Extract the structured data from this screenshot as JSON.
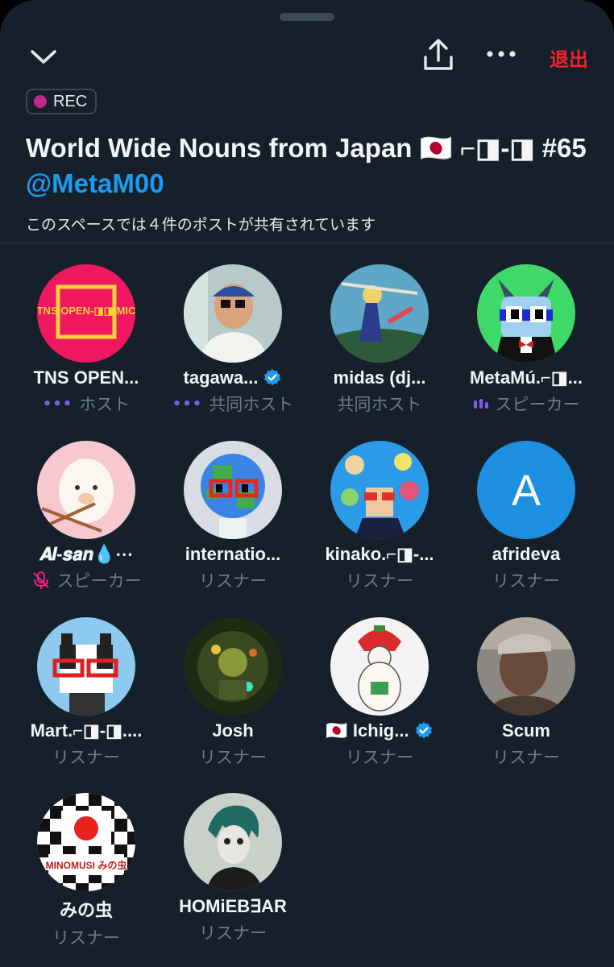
{
  "header": {
    "leave_label": "退出",
    "rec_label": "REC",
    "title_text": "World Wide Nouns from Japan 🇯🇵 ⌐◨-◨ #65",
    "title_handle": "@MetaM00",
    "subtitle": "このスペースでは４件のポストが共有されています",
    "colors": {
      "accent": "#1d9bf0",
      "leave": "#f4212e",
      "rec": "#c2278a",
      "background": "#15202b"
    }
  },
  "participants": [
    {
      "name": "TNS OPEN...",
      "role": "ホスト",
      "role_indicator": "speaking-dots",
      "avatar": "open-mic-logo",
      "avatar_text": "TNS OPEN-◨◨ MIC",
      "avatar_color": "#f0185f"
    },
    {
      "name": "tagawa...",
      "role": "共同ホスト",
      "role_indicator": "speaking-dots",
      "verified": true,
      "avatar": "photo-man-cap",
      "avatar_color": "#b7c9c9"
    },
    {
      "name": "midas (dj...",
      "role": "共同ホスト",
      "avatar": "anime-illustration",
      "avatar_color": "#5fa7c6"
    },
    {
      "name": "MetaMú.⌐◨...",
      "role": "スピーカー",
      "role_indicator": "speaking-bars",
      "avatar": "cat-noggles",
      "avatar_color": "#3fd96a"
    },
    {
      "name": "𝑨𝒍-𝒔𝒂𝒏💧⋯",
      "role": "スピーカー",
      "role_indicator": "mic-muted",
      "avatar": "alpaca",
      "avatar_color": "#f7c8cf"
    },
    {
      "name": "internatio...",
      "role": "リスナー",
      "avatar": "pixel-globe",
      "avatar_color": "#d9dce3"
    },
    {
      "name": "kinako.⌐◨-...",
      "role": "リスナー",
      "avatar": "nouns-bubbles",
      "avatar_color": "#2b9be8"
    },
    {
      "name": "afrideva",
      "role": "リスナー",
      "avatar": "letter",
      "avatar_text": "A",
      "avatar_color": "#1d8fe1"
    },
    {
      "name": "Mart.⌐◨-◨....",
      "role": "リスナー",
      "avatar": "pixel-cat",
      "avatar_color": "#8ec9ef"
    },
    {
      "name": "Josh",
      "role": "リスナー",
      "avatar": "robot-art",
      "avatar_color": "#3a4a20"
    },
    {
      "name": "🇯🇵 Ichig...",
      "role": "リスナー",
      "verified": true,
      "avatar": "strawberry-doll",
      "avatar_color": "#f3f3f3"
    },
    {
      "name": "Scum",
      "role": "リスナー",
      "avatar": "photo-man",
      "avatar_color": "#5a4a40"
    },
    {
      "name": "みの虫",
      "role": "リスナー",
      "avatar": "checker-japan",
      "avatar_text": "MINOMUSI みの虫",
      "avatar_color": "#ffffff"
    },
    {
      "name": "HOMiEB∃AR",
      "role": "リスナー",
      "avatar": "skull-character",
      "avatar_color": "#c9cfc9"
    }
  ]
}
